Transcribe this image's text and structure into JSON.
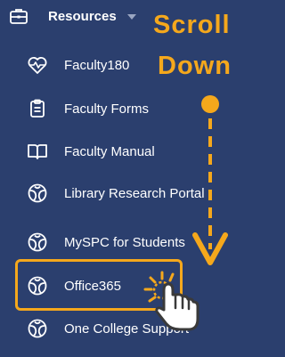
{
  "header": {
    "label": "Resources",
    "icon": "toolbox-icon"
  },
  "items": [
    {
      "label": "Faculty180",
      "icon": "heartbeat-icon"
    },
    {
      "label": "Faculty Forms",
      "icon": "clipboard-icon"
    },
    {
      "label": "Faculty Manual",
      "icon": "book-icon"
    },
    {
      "label": "Library Research Portal",
      "icon": "spc-logo-icon"
    },
    {
      "label": "MySPC for Students",
      "icon": "spc-logo-icon"
    },
    {
      "label": "Office365",
      "icon": "spc-logo-icon"
    },
    {
      "label": "One College Support",
      "icon": "spc-logo-icon"
    }
  ],
  "overlay": {
    "line1": "Scroll",
    "line2": "Down"
  },
  "colors": {
    "background": "#2b3f6e",
    "accent": "#f5a81c",
    "text": "#ffffff"
  }
}
